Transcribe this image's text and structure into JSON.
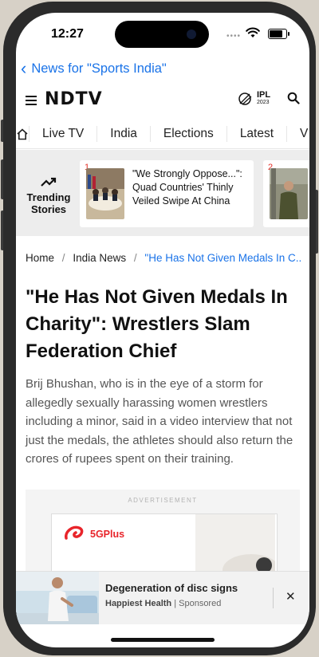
{
  "status_bar": {
    "time": "12:27",
    "battery_level": 0.9
  },
  "nav": {
    "back_label": "News for \"Sports India\""
  },
  "header": {
    "logo": "NDTV",
    "ipl_badge": "IPL",
    "ipl_year": "2023"
  },
  "tabs": [
    {
      "label": "Live TV"
    },
    {
      "label": "India"
    },
    {
      "label": "Elections"
    },
    {
      "label": "Latest"
    },
    {
      "label": "V"
    }
  ],
  "trending": {
    "label_line1": "Trending",
    "label_line2": "Stories",
    "cards": [
      {
        "number": "1",
        "headline": "\"We Strongly Oppose...\": Quad Countries' Thinly Veiled Swipe At China"
      },
      {
        "number": "2",
        "headline": ""
      }
    ]
  },
  "breadcrumb": {
    "items": [
      "Home",
      "India News"
    ],
    "current": "\"He Has Not Given Medals In C..."
  },
  "article": {
    "title": "\"He Has Not Given Medals In Charity\": Wrestlers Slam Federation Chief",
    "summary": "Brij Bhushan, who is in the eye of a storm for allegedly sexually harassing women wrestlers including a minor, said in a video interview that not just the medals, the athletes should also return the crores of rupees spent on their training."
  },
  "ad": {
    "label": "ADVERTISEMENT",
    "brand": "5GPlus"
  },
  "sponsored": {
    "title": "Degeneration of disc signs",
    "source": "Happiest Health",
    "tag": "Sponsored"
  },
  "colors": {
    "accent": "#1a73e8",
    "brand_red": "#e52d27"
  }
}
